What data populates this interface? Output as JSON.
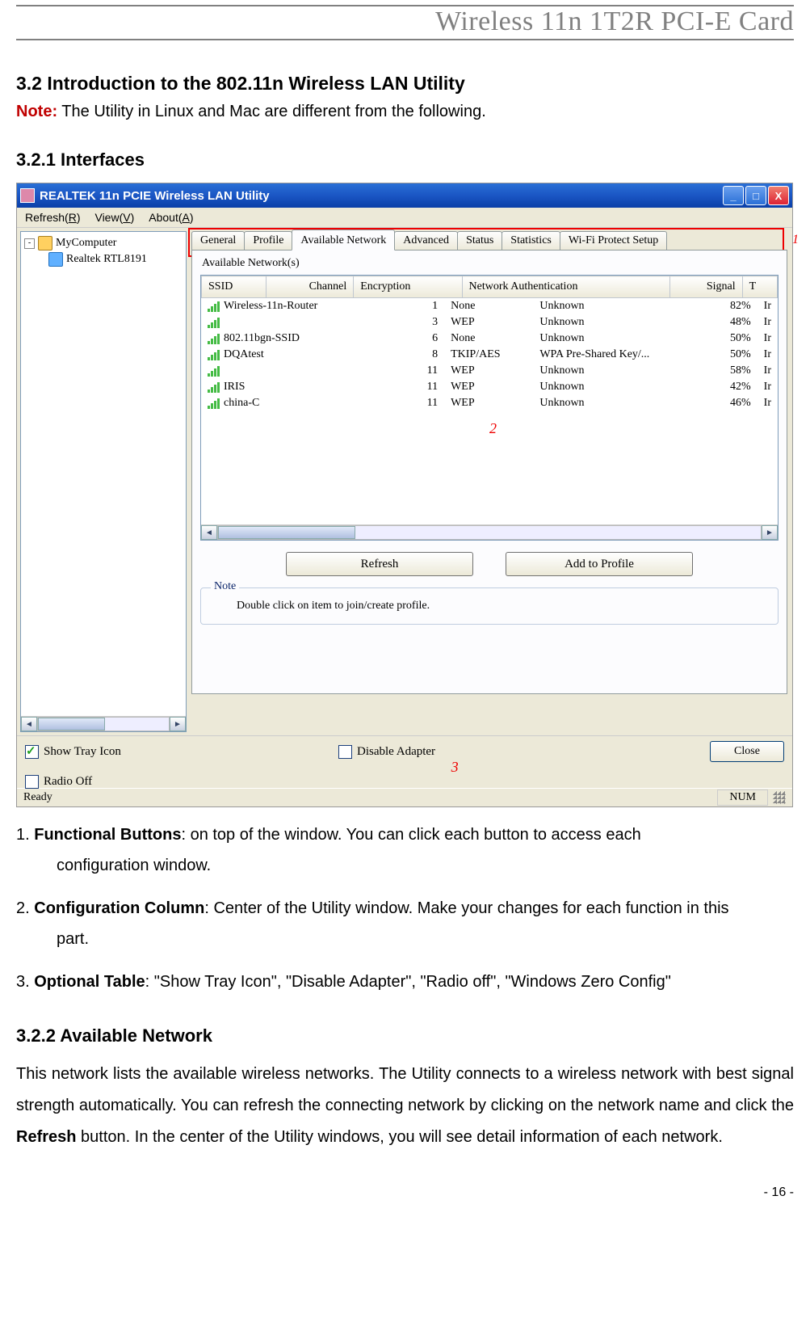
{
  "header": {
    "title": "Wireless 11n 1T2R PCI-E Card"
  },
  "section": {
    "h2": "3.2 Introduction to the 802.11n Wireless LAN Utility",
    "note_label": "Note:",
    "note_text": " The Utility in Linux and Mac are different from the following.",
    "h3_1": "3.2.1    Interfaces",
    "h3_2": "3.2.2    Available Network"
  },
  "screenshot": {
    "title": "REALTEK 11n PCIE Wireless LAN Utility",
    "win_min": "_",
    "win_max": "□",
    "win_close": "X",
    "menu": {
      "refresh": "Refresh(R)",
      "view": "View(V)",
      "about": "About(A)"
    },
    "tree": {
      "root": "MyComputer",
      "child": "Realtek RTL8191"
    },
    "tabs": [
      "General",
      "Profile",
      "Available Network",
      "Advanced",
      "Status",
      "Statistics",
      "Wi-Fi Protect Setup"
    ],
    "active_tab_index": 2,
    "callouts": {
      "one": "1",
      "two": "2",
      "three": "3"
    },
    "panel": {
      "fs_title": "Available Network(s)",
      "columns": [
        "SSID",
        "Channel",
        "Encryption",
        "Network Authentication",
        "Signal",
        "T"
      ],
      "rows": [
        {
          "ssid": "Wireless-11n-Router",
          "ch": "1",
          "enc": "None",
          "auth": "Unknown",
          "sig": "82%",
          "t": "Ir"
        },
        {
          "ssid": "",
          "ch": "3",
          "enc": "WEP",
          "auth": "Unknown",
          "sig": "48%",
          "t": "Ir"
        },
        {
          "ssid": "802.11bgn-SSID",
          "ch": "6",
          "enc": "None",
          "auth": "Unknown",
          "sig": "50%",
          "t": "Ir"
        },
        {
          "ssid": "DQAtest",
          "ch": "8",
          "enc": "TKIP/AES",
          "auth": "WPA Pre-Shared Key/...",
          "sig": "50%",
          "t": "Ir"
        },
        {
          "ssid": "",
          "ch": "11",
          "enc": "WEP",
          "auth": "Unknown",
          "sig": "58%",
          "t": "Ir"
        },
        {
          "ssid": "IRIS",
          "ch": "11",
          "enc": "WEP",
          "auth": "Unknown",
          "sig": "42%",
          "t": "Ir"
        },
        {
          "ssid": "china-C",
          "ch": "11",
          "enc": "WEP",
          "auth": "Unknown",
          "sig": "46%",
          "t": "Ir"
        }
      ],
      "refresh_btn": "Refresh",
      "add_btn": "Add to Profile",
      "note_title": "Note",
      "note_body": "Double click on item to join/create profile."
    },
    "checks": {
      "show_tray": "Show Tray Icon",
      "disable_adapter": "Disable Adapter",
      "radio_off": "Radio Off"
    },
    "close_btn": "Close",
    "status": {
      "ready": "Ready",
      "num": "NUM"
    }
  },
  "descriptions": {
    "d1a": "1.  ",
    "d1b": "Functional Buttons",
    "d1c": ": on top of the window. You can click each button to access each",
    "d1d": "configuration window.",
    "d2a": "2. ",
    "d2b": "Configuration Column",
    "d2c": ": Center of the Utility window. Make your changes for each function in this",
    "d2d": "part.",
    "d3a": "3. ",
    "d3b": "Optional Table",
    "d3c": ": \"Show Tray Icon\", \"Disable Adapter\", \"Radio off\", \"Windows Zero Config\""
  },
  "para2": {
    "t1": "This network lists the available wireless networks. The Utility connects to a wireless network with best signal strength automatically. You can refresh the connecting network by clicking on the network name and click the ",
    "bold": "Refresh",
    "t2": " button. In the center of the Utility windows, you will see detail information of each network."
  },
  "footer": "- 16 -"
}
